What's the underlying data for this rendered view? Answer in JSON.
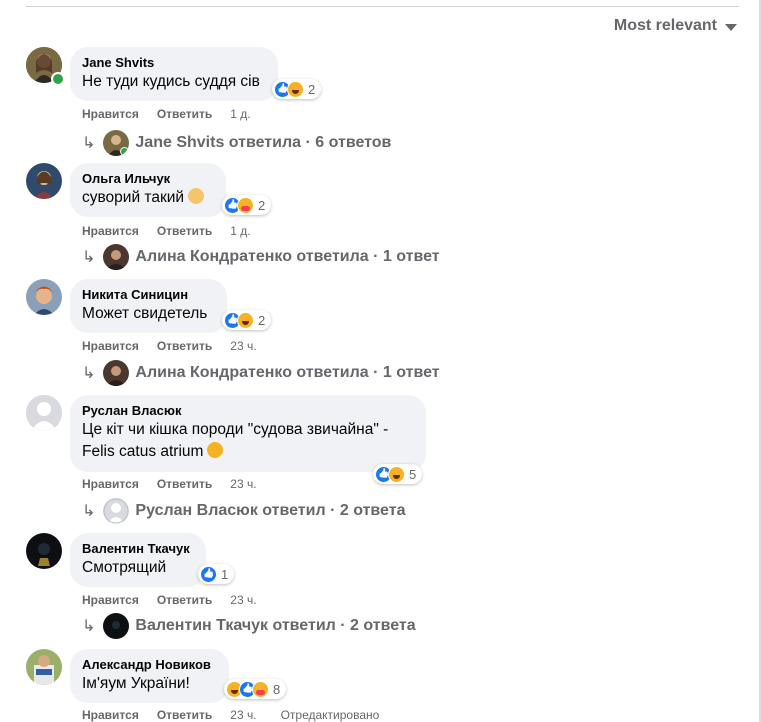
{
  "sort": {
    "label": "Most relevant",
    "icon": "caret-down-icon"
  },
  "actions": {
    "like": "Нравится",
    "reply": "Ответить"
  },
  "comments": [
    {
      "author": "Jane Shvits",
      "text": "Не туди кудись суддя сів",
      "reactions": {
        "icons": [
          "like",
          "haha"
        ],
        "count": "2"
      },
      "time": "1 д.",
      "replies": "Jane Shvits ответила · 6 ответов"
    },
    {
      "author": "Ольга Ильчук",
      "text": "суворий такий",
      "reactions": {
        "icons": [
          "like",
          "care"
        ],
        "count": "2"
      },
      "time": "1 д.",
      "replies": "Алина Кондратенко ответила · 1 ответ"
    },
    {
      "author": "Никита Синицин",
      "text": "Может свидетель",
      "reactions": {
        "icons": [
          "like",
          "haha"
        ],
        "count": "2"
      },
      "time": "23 ч.",
      "replies": "Алина Кондратенко ответила · 1 ответ"
    },
    {
      "author": "Руслан Власюк",
      "text_line1": "Це кіт чи кішка породи \"судова звичайна\" -",
      "text_line2": "Felis catus atrium",
      "reactions": {
        "icons": [
          "like",
          "haha"
        ],
        "count": "5"
      },
      "time": "23 ч.",
      "replies": "Руслан Власюк ответил · 2 ответа"
    },
    {
      "author": "Валентин Ткачук",
      "text": "Смотрящий",
      "reactions": {
        "icons": [
          "like"
        ],
        "count": "1"
      },
      "time": "23 ч.",
      "replies": "Валентин Ткачук ответил · 2 ответа"
    },
    {
      "author": "Александр Новиков",
      "text": "Ім'яум України!",
      "reactions": {
        "icons": [
          "haha",
          "like",
          "care"
        ],
        "count": "8"
      },
      "time": "23 ч.",
      "edited": "Отредактировано"
    }
  ]
}
